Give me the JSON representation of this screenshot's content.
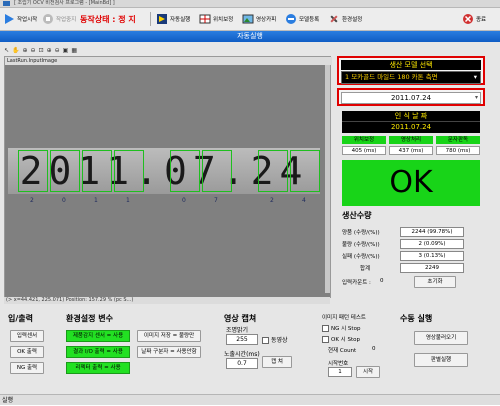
{
  "window": {
    "title": "[ 조립기 OCV 비전검사 프로그램 - [MainBd] ]"
  },
  "toolbar": {
    "start_label": "작업시작",
    "stop_label": "작업중지",
    "status_text": "동작상태 : 정  지",
    "auto_label": "자동실행",
    "position_label": "위치보정",
    "image_label": "영상카피",
    "model_label": "모델등록",
    "env_label": "환경설정",
    "exit_label": "종료"
  },
  "banner": {
    "title": "자동실행"
  },
  "image_panel": {
    "header": "LastRun.InputImage",
    "date_text": "2011.07.24",
    "digit_labels": [
      "2",
      "0",
      "1",
      "1",
      "0",
      "7",
      "2",
      "4"
    ],
    "coord_text": "(> x=44.421, 225.071)     Position: 157.29 % (pc S...)"
  },
  "model_select": {
    "header": "생산 모델 선택",
    "selected": "1 모카골드 마일드 180 카톤 측면"
  },
  "date_field": {
    "value": "2011.07.24"
  },
  "inspection": {
    "header": "인 식 날 짜",
    "date": "2011.07.24",
    "cols": [
      {
        "label": "위치보정",
        "value": "405 (ms)"
      },
      {
        "label": "영상처리",
        "value": "437 (ms)"
      },
      {
        "label": "문자판독",
        "value": "780 (ms)"
      }
    ],
    "result": "OK"
  },
  "production": {
    "title": "생산수량",
    "rows": [
      {
        "label": "양품 (수량/(%))",
        "value": "2244 (99.78%)"
      },
      {
        "label": "불량 (수량/(%))",
        "value": "2 (0.09%)"
      },
      {
        "label": "실패 (수량/(%))",
        "value": "3 (0.13%)"
      },
      {
        "label": "합계",
        "value": "2249"
      }
    ],
    "input_count_label": "입력카운트 :",
    "input_count_value": "0",
    "reset_label": "초기화"
  },
  "io": {
    "title": "입/출력",
    "buttons": [
      "입력센서",
      "OK 출력",
      "NG 출력"
    ]
  },
  "env": {
    "title": "환경설정 변수",
    "green_items": [
      "제품감지 센서 = 사용",
      "결과 I/O 출력 = 사용",
      "리젝터 출력 = 사용"
    ],
    "white_items": [
      "이미지 저장 = 불량만",
      "날짜 구분자 = 사용안함"
    ]
  },
  "capture": {
    "title": "영상 캡쳐",
    "brightness_label": "조명밝기",
    "brightness_value": "255",
    "exposure_label": "노출시간(ms)",
    "exposure_value": "0.7",
    "video_label": "동영상",
    "capture_button": "캡 쳐"
  },
  "test": {
    "title": "이미지 패턴 테스트",
    "ng_stop": "NG 시 Stop",
    "ok_stop": "OK 시 Stop",
    "current_count_label": "현재 Count",
    "current_count_value": "0",
    "start_no_label": "시작번호",
    "start_no_value": "1",
    "start_button": "시작"
  },
  "manual": {
    "title": "수동 실행",
    "load_button": "영상불러오기",
    "run_button": "판별실행"
  },
  "statusbar": {
    "text": "실행"
  }
}
